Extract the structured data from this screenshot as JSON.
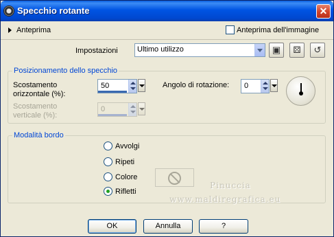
{
  "window": {
    "title": "Specchio rotante",
    "close_label": "✕"
  },
  "preview": {
    "label": "Anteprima",
    "image_preview_label": "Anteprima dell'immagine",
    "image_preview_checked": false
  },
  "settings": {
    "label": "Impostazioni",
    "selected": "Ultimo utilizzo"
  },
  "mirror_group": {
    "legend": "Posizionamento dello specchio",
    "horizontal_label_line1": "Scostamento",
    "horizontal_label_line2": "orizzontale (%):",
    "horizontal_value": "50",
    "vertical_label_line1": "Scostamento",
    "vertical_label_line2": "verticale (%):",
    "vertical_value": "0",
    "rotation_label": "Angolo di rotazione:",
    "rotation_value": "0"
  },
  "border_group": {
    "legend": "Modalità bordo",
    "options": [
      "Avvolgi",
      "Ripeti",
      "Colore",
      "Rifletti"
    ],
    "selected": "Rifletti"
  },
  "watermark": {
    "line1": "Pinuccia",
    "line2": "www.maldiregrafica.eu"
  },
  "buttons": {
    "ok": "OK",
    "cancel": "Annulla",
    "help": "?"
  },
  "colors": {
    "titlebar": "#0054e3",
    "legend": "#0046d5",
    "dialog_bg": "#ece9d8"
  }
}
